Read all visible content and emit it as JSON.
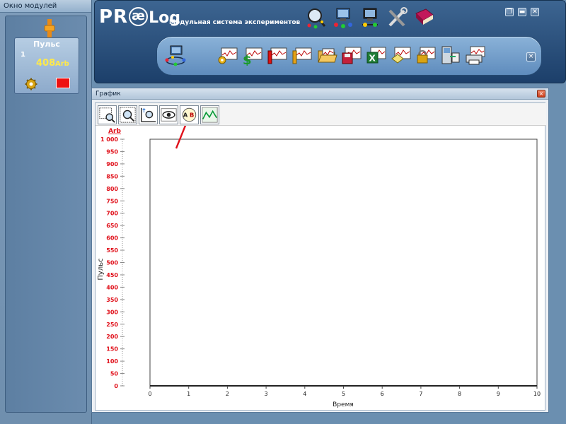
{
  "module_window": {
    "title": "Окно модулей",
    "module": {
      "name": "Пульс",
      "number": "1",
      "value": "408",
      "unit": "Arb",
      "settings_icon": "gear-icon",
      "status_color": "#ee1111"
    }
  },
  "banner": {
    "logo_pr": "PR",
    "logo_ae": "æ",
    "logo_log": "Log",
    "subtitle": "Модульная система экспериментов",
    "top_icons": [
      "search-module-icon",
      "computer-network-icon",
      "computer-connect-icon",
      "tools-icon",
      "help-book-icon"
    ],
    "window_controls": [
      "restore-icon",
      "minimize-icon",
      "close-icon"
    ]
  },
  "toolbar": {
    "icons": [
      "connect-sensor-icon",
      "graph-settings-icon",
      "graph-dollar-icon",
      "graph-info-icon",
      "graph-marker-icon",
      "open-folder-icon",
      "save-disk-icon",
      "export-excel-icon",
      "graph-eraser-icon",
      "graph-lock-icon",
      "device-transfer-icon",
      "print-icon"
    ],
    "close_label": "×"
  },
  "graph_window": {
    "title": "График",
    "close_label": "×",
    "tools": [
      "zoom-area-icon",
      "zoom-fit-icon",
      "zoom-axis-icon",
      "eye-icon",
      "auto-scale-icon",
      "curve-icon"
    ],
    "y_unit": "Arb",
    "y_axis_label": "Пульс",
    "x_axis_label": "Время"
  },
  "chart_data": {
    "type": "line",
    "xlabel": "Время",
    "ylabel": "Пульс",
    "y_unit": "Arb",
    "xlim": [
      0,
      10
    ],
    "ylim": [
      0,
      1000
    ],
    "x_ticks": [
      "0",
      "1",
      "2",
      "3",
      "4",
      "5",
      "6",
      "7",
      "8",
      "9",
      "10"
    ],
    "y_ticks": [
      "0",
      "50",
      "100",
      "150",
      "200",
      "250",
      "300",
      "350",
      "400",
      "450",
      "500",
      "550",
      "600",
      "650",
      "700",
      "750",
      "800",
      "850",
      "900",
      "950",
      "1 000"
    ],
    "series": [],
    "grid": false,
    "annotation_color": "#e0101a"
  }
}
